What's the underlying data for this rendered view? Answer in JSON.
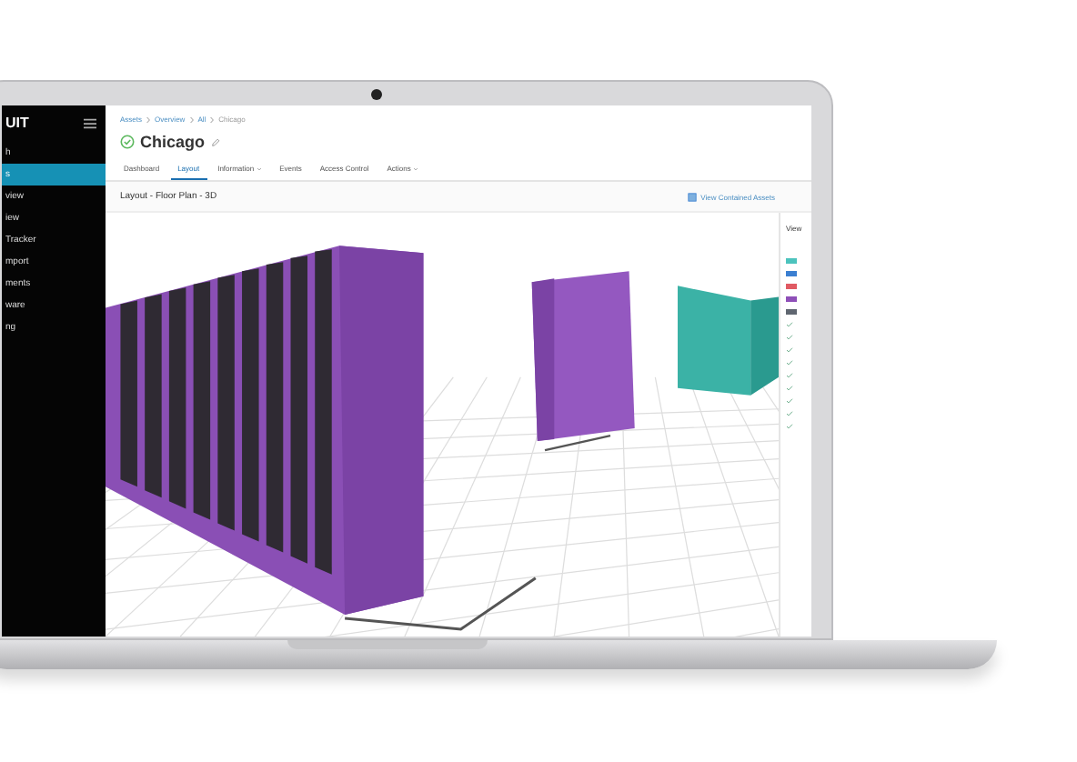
{
  "sidebar": {
    "logo": "UIT",
    "items": [
      {
        "label": "h",
        "selected": false
      },
      {
        "label": "s",
        "selected": true
      },
      {
        "label": "view",
        "selected": false
      },
      {
        "label": "iew",
        "selected": false
      },
      {
        "label": "Tracker",
        "selected": false
      },
      {
        "label": "mport",
        "selected": false
      },
      {
        "label": "ments",
        "selected": false
      },
      {
        "label": "ware",
        "selected": false
      },
      {
        "label": "ng",
        "selected": false
      }
    ]
  },
  "breadcrumbs": [
    "Assets",
    "Overview",
    "All",
    "Chicago"
  ],
  "title": "Chicago",
  "tabs": [
    {
      "label": "Dashboard",
      "selected": false
    },
    {
      "label": "Layout",
      "selected": true
    },
    {
      "label": "Information",
      "selected": false,
      "dropdown": true
    },
    {
      "label": "Events",
      "selected": false
    },
    {
      "label": "Access Control",
      "selected": false
    },
    {
      "label": "Actions",
      "selected": false,
      "dropdown": true
    }
  ],
  "section_title": "Layout - Floor Plan - 3D",
  "view_assets_link": "View Contained Assets",
  "panel": {
    "title": "View",
    "legend": [
      {
        "color": "#4cc3bd"
      },
      {
        "color": "#3b7fd1"
      },
      {
        "color": "#e05a63"
      },
      {
        "color": "#8e4fb8"
      },
      {
        "color": "#5f6670"
      }
    ],
    "checks": [
      {
        "checked": true
      },
      {
        "checked": true
      },
      {
        "checked": true
      },
      {
        "checked": true
      },
      {
        "checked": true
      },
      {
        "checked": true
      },
      {
        "checked": true
      },
      {
        "checked": true
      },
      {
        "checked": true
      }
    ]
  }
}
